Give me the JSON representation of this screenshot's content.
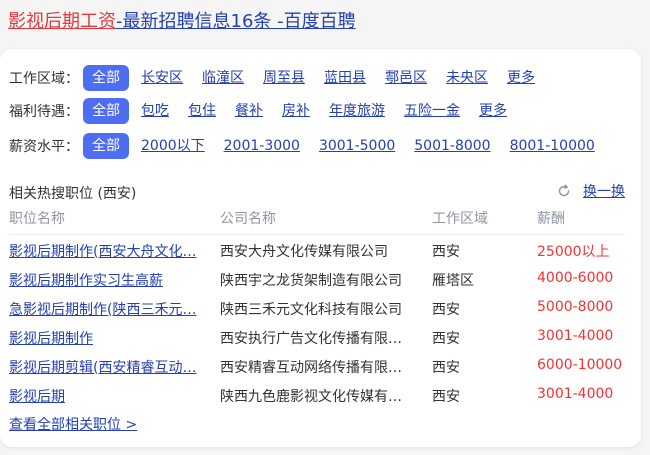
{
  "title": {
    "part1": "影视后期工资",
    "part2": "-最新招聘信息16条 -百度百聘"
  },
  "filters": [
    {
      "label": "工作区域：",
      "options": [
        "全部",
        "长安区",
        "临潼区",
        "周至县",
        "蓝田县",
        "鄠邑区",
        "未央区",
        "更多"
      ]
    },
    {
      "label": "福利待遇：",
      "options": [
        "全部",
        "包吃",
        "包住",
        "餐补",
        "房补",
        "年度旅游",
        "五险一金",
        "更多"
      ]
    },
    {
      "label": "薪资水平：",
      "options": [
        "全部",
        "2000以下",
        "2001-3000",
        "3001-5000",
        "5001-8000",
        "8001-10000"
      ]
    }
  ],
  "section": {
    "title": "相关热搜职位 (西安)",
    "refresh_label": "换一换",
    "refresh_icon": "refresh-icon"
  },
  "table": {
    "headers": [
      "职位名称",
      "公司名称",
      "工作区域",
      "薪酬"
    ],
    "rows": [
      [
        "影视后期制作(西安大舟文化…",
        "西安大舟文化传媒有限公司",
        "西安",
        "25000以上"
      ],
      [
        "影视后期制作实习生高薪",
        "陕西宇之龙货架制造有限公司",
        "雁塔区",
        "4000-6000"
      ],
      [
        "急影视后期制作(陕西三禾元…",
        "陕西三禾元文化科技有限公司",
        "西安",
        "5000-8000"
      ],
      [
        "影视后期制作",
        "西安执行广告文化传播有限…",
        "西安",
        "3001-4000"
      ],
      [
        "影视后期剪辑(西安精睿互动…",
        "西安精睿互动网络传播有限…",
        "西安",
        "6000-10000"
      ],
      [
        "影视后期",
        "陕西九色鹿影视文化传媒有…",
        "西安",
        "3001-4000"
      ]
    ]
  },
  "view_all": "查看全部相关职位 >",
  "colors": {
    "link": "#2440b3",
    "accent": "#4e6ef2",
    "salary": "#f73131",
    "title_red": "#e4393c"
  }
}
